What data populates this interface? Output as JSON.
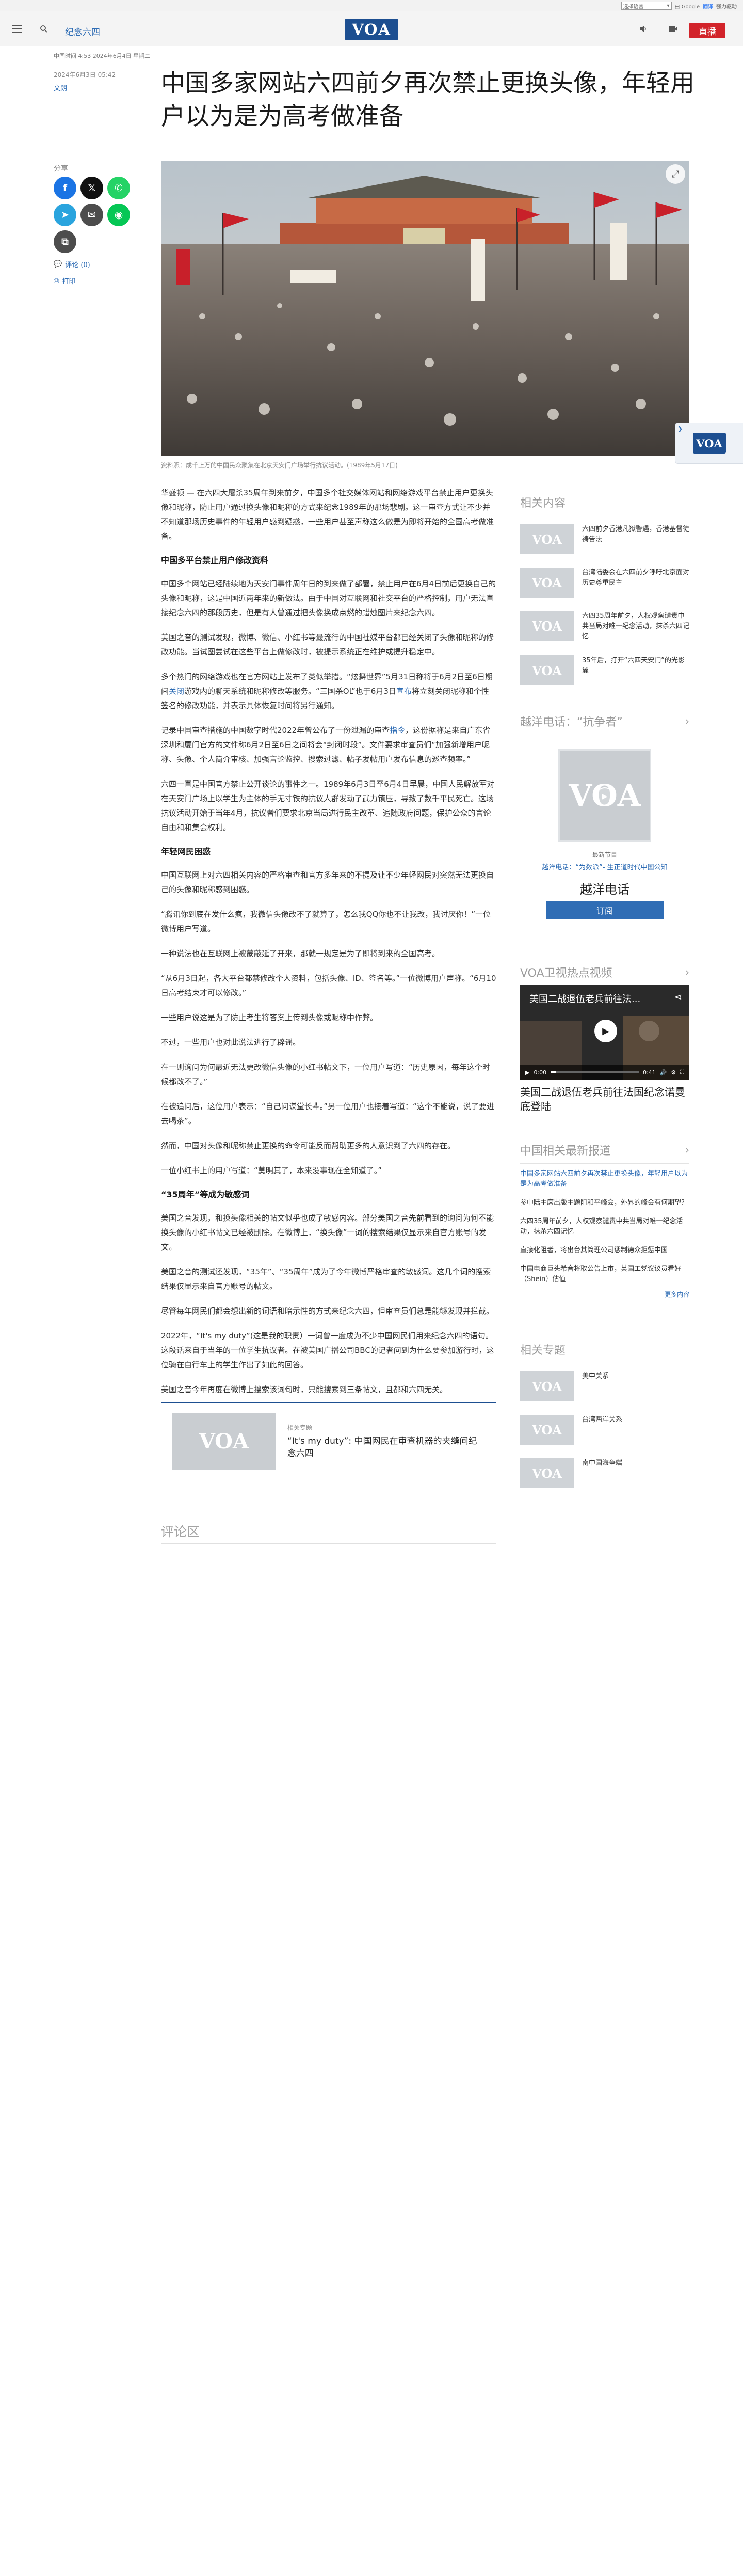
{
  "translate": {
    "select_label": "选择语言",
    "select_chevron": "▾",
    "powered_by": "由 Google",
    "brand": "翻译",
    "brand_suffix": "强力驱动"
  },
  "header": {
    "section": "纪念六四",
    "logo": "VOA",
    "live_label": "直播",
    "icons": [
      "menu-icon",
      "search-icon",
      "audio-icon",
      "video-icon"
    ]
  },
  "article": {
    "dateline": "中国时间 4:53 2024年6月4日 星期二",
    "date": "2024年6月3日 05:42",
    "author": "文朗",
    "title": "中国多家网站六四前夕再次禁止更换头像，年轻用户以为是为高考做准备",
    "share_label": "分享",
    "comments_label": "评论 (0)",
    "print_label": "打印",
    "caption": "资料照：成千上万的中国民众聚集在北京天安门广场举行抗议活动。(1989年5月17日)",
    "comments_heading": "评论区"
  },
  "body": {
    "p1": "华盛顿 — 在六四大屠杀35周年到来前夕，中国多个社交媒体网站和网络游戏平台禁止用户更换头像和昵称，防止用户通过换头像和昵称的方式来纪念1989年的那场悲剧。这一审查方式让不少并不知道那场历史事件的年轻用户感到疑惑，一些用户甚至声称这么做是为即将开始的全国高考做准备。",
    "h1": "中国多平台禁止用户修改资料",
    "p2": "中国多个网站已经陆续地为天安门事件周年日的到来做了部署，禁止用户在6月4日前后更换自己的头像和昵称，这是中国近两年来的新做法。由于中国对互联网和社交平台的严格控制，用户无法直接纪念六四的那段历史，但是有人曾通过把头像换成点燃的蜡烛图片来纪念六四。",
    "p3": "美国之音的测试发现，微博、微信、小红书等最流行的中国社媒平台都已经关闭了头像和昵称的修改功能。当试图尝试在这些平台上做修改时，被提示系统正在维护或提升稳定中。",
    "p4a": "多个热门的网络游戏也在官方网站上发布了类似举措。“炫舞世界”5月31日称将于6月2日至6日期间",
    "p4link": "关闭",
    "p4b": "游戏内的聊天系统和昵称修改等服务。“三国杀OL”也于6月3日",
    "p4link2": "宣布",
    "p4c": "将立刻关闭昵称和个性签名的修改功能，并表示具体恢复时间将另行通知。",
    "p5a": "记录中国审查措施的中国数字时代2022年曾公布了一份泄漏的审查",
    "p5link": "指令",
    "p5b": "，这份据称是来自广东省深圳和厦门官方的文件称6月2日至6日之间将会“封闭时段”。文件要求审查员们“加强新增用户昵称、头像、个人简介审核、加强言论监控、搜索过滤、帖子发帖用户发布信息的巡查频率。”",
    "p6": "六四一直是中国官方禁止公开谈论的事件之一。1989年6月3日至6月4日早晨，中国人民解放军对在天安门广场上以学生为主体的手无寸铁的抗议人群发动了武力镇压，导致了数千平民死亡。这场抗议活动开始于当年4月，抗议者们要求北京当局进行民主改革、追随政府问题，保护公众的言论自由和和集会权利。",
    "h2": "年轻网民困惑",
    "p7": "中国互联网上对六四相关内容的严格审查和官方多年来的不提及让不少年轻网民对突然无法更换自己的头像和昵称感到困惑。",
    "p8": "“腾讯你到底在发什么疯，我微信头像改不了就算了，怎么我QQ你也不让我改，我讨厌你！”一位微博用户写道。",
    "p9": "一种说法也在互联网上被蒙蔽延了开来，那就一规定是为了即将到来的全国高考。",
    "p10": "“从6月3日起，各大平台都禁修改个人资料，包括头像、ID、签名等。”一位微博用户声称。“6月10日高考结束才可以修改。”",
    "p11": "一些用户说这是为了防止考生将答案上传到头像或昵称中作弊。",
    "p12": "不过，一些用户也对此说法进行了辟谣。",
    "p13": "在一则询问为何最近无法更改微信头像的小红书帖文下，一位用户写道：“历史原因，每年这个时候都改不了。”",
    "p14": "在被追问后，这位用户表示：“自己问谋堂长辈。”另一位用户也接着写道：“这个不能说，说了要进去喝茶”。",
    "p15": "然而，中国对头像和昵称禁止更换的命令可能反而帮助更多的人意识到了六四的存在。",
    "p16": "一位小红书上的用户写道：“莫明其了，本来没事现在全知道了。”",
    "h3": "“35周年”等成为敏感词",
    "p17": "美国之音发现，和换头像相关的帖文似乎也成了敏感内容。部分美国之音先前看到的询问为何不能换头像的小红书帖文已经被删除。在微博上，“换头像”一词的搜索结果仅显示来自官方账号的发文。",
    "p18": "美国之音的测试还发现，“35年”、“35周年”成为了今年微博严格审查的敏感词。这几个词的搜索结果仅显示来自官方账号的帖文。",
    "p19": "尽管每年网民们都会想出新的词语和暗示性的方式来纪念六四，但审查员们总是能够发现并拦截。",
    "p20": "2022年，“It's my duty”(这是我的职责）一词曾一度成为不少中国网民们用来纪念六四的语句。这段话来自于当年的一位学生抗议者。在被美国广播公司BBC的记者问到为什么要参加游行时，这位骑在自行车上的学生作出了如此的回答。",
    "p21": "美国之音今年再度在微博上搜索该词句时，只能搜索到三条帖文，且都和六四无关。"
  },
  "related_card": {
    "kicker": "相关专题",
    "title": "“It's my duty”: 中国网民在审查机器的夹缝间纪念六四"
  },
  "rail": {
    "related_heading": "相关内容",
    "related": [
      "六四前夕香港凡狱警遇，香港基督徒祷告法",
      "台湾陆委会在六四前夕呼吁北京面对历史尊重民主",
      "六四35周年前夕，人权观察谴责中共当局对唯一纪念活动，抹杀六四记忆",
      "35年后，打开“六四天安门”的光影翼"
    ],
    "podcast_heading": "越洋电话：“抗争者”",
    "podcast_label": "最新节目",
    "podcast_name": "越洋电话：“为数派”- 生正道时代中国公知",
    "podcast_title": "越洋电话",
    "subscribe_label": "订阅",
    "video_heading": "VOA卫视热点视频",
    "video_overlay": "美国二战退伍老兵前往法...",
    "video_time_start": "0:00",
    "video_time_end": "0:41",
    "video_progress": 0.06,
    "video_caption": "美国二战退伍老兵前往法国纪念诺曼底登陆",
    "latest_heading": "中国相关最新报道",
    "latest": [
      "中国多家网站六四前夕再次禁止更换头像，年轻用户以为是为高考做准备",
      "参中陆主席出版主题阻和平峰会，外界的峰会有何期望？",
      "六四35周年前夕，人权观察谴责中共当局对唯一纪念活动，抹杀六四记忆",
      "直接化阻者，将出台其简理公司惩制德众拒惩中国",
      "中国电商巨头希音将取公告上市，英国工党议议员看好（Shein）估值"
    ],
    "latest_more": "更多内容",
    "topics_heading": "相关专题",
    "topics": [
      "美中关系",
      "台湾两岸关系",
      "南中国海争端"
    ],
    "float_badge": "VOA"
  },
  "colors": {
    "brand": "#1d4f91",
    "accent_link": "#2f6db5",
    "live_red": "#d2232a"
  }
}
